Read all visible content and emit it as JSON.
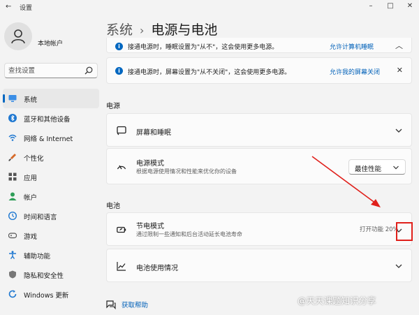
{
  "window": {
    "title": "设置",
    "colors": {
      "accent": "#0067c0",
      "link": "#0060b8",
      "annotation_red": "#e0201b"
    }
  },
  "sidebar": {
    "account_name": "本地帐户",
    "search_placeholder": "查找设置",
    "items": [
      {
        "label": "系统",
        "icon": "monitor-icon",
        "active": true
      },
      {
        "label": "蓝牙和其他设备",
        "icon": "bluetooth-icon"
      },
      {
        "label": "网络 & Internet",
        "icon": "wifi-icon"
      },
      {
        "label": "个性化",
        "icon": "brush-icon"
      },
      {
        "label": "应用",
        "icon": "apps-icon"
      },
      {
        "label": "帐户",
        "icon": "person-icon"
      },
      {
        "label": "时间和语言",
        "icon": "globe-clock-icon"
      },
      {
        "label": "游戏",
        "icon": "gamepad-icon"
      },
      {
        "label": "辅助功能",
        "icon": "accessibility-icon"
      },
      {
        "label": "隐私和安全性",
        "icon": "shield-icon"
      },
      {
        "label": "Windows 更新",
        "icon": "update-icon"
      }
    ]
  },
  "main": {
    "breadcrumb_parent": "系统",
    "breadcrumb_separator": "›",
    "page_title": "电源与电池",
    "notice_partial": {
      "text": "接通电源时，睡眠设置为\"从不\"，这会使用更多电源。",
      "link": "允许计算机睡眠"
    },
    "notice": {
      "text": "接通电源时，屏幕设置为\"从不关闭\"，这会使用更多电源。",
      "link": "允许我的屏幕关闭"
    },
    "section_power": "电源",
    "screen_sleep": {
      "title": "屏幕和睡眠"
    },
    "power_mode": {
      "title": "电源模式",
      "subtitle": "根据电源使用情况和性能来优化你的设备",
      "selected": "最佳性能"
    },
    "section_battery": "电池",
    "battery_saver": {
      "title": "节电模式",
      "subtitle": "通过限制一些通知和后台活动延长电池寿命",
      "status": "打开功能 20%"
    },
    "battery_usage": {
      "title": "电池使用情况"
    },
    "help_link": "获取帮助"
  },
  "watermark": "@天天课题知识分享"
}
